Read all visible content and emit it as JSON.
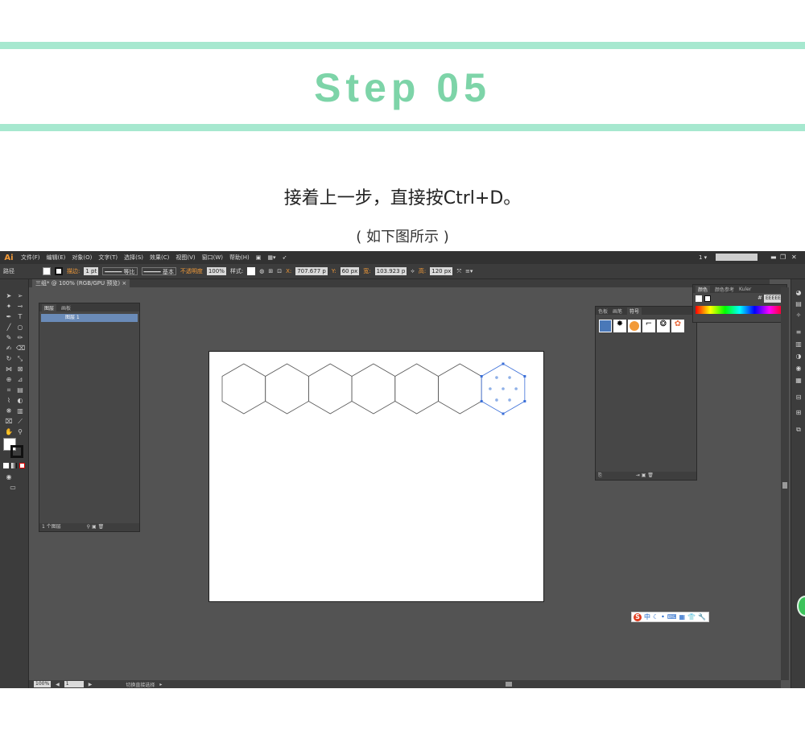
{
  "header": {
    "step_title": "Step 05"
  },
  "instruction": "接着上一步，直接按Ctrl+D。",
  "caption": "( 如下图所示 )",
  "colors": {
    "accent_bar": "#a6e8cf",
    "title_green": "#7dd4a8",
    "ai_orange": "#f29a38",
    "ui_dark": "#535353",
    "selection_blue": "#3b6fd8"
  },
  "app": {
    "logo": "Ai",
    "menu": [
      "文件(F)",
      "编辑(E)",
      "对象(O)",
      "文字(T)",
      "选择(S)",
      "效果(C)",
      "视图(V)",
      "窗口(W)",
      "帮助(H)"
    ],
    "page_indicator": "1 ▾",
    "search_placeholder": "",
    "control_bar": {
      "object_type": "路径",
      "stroke_label": "描边:",
      "stroke_weight": "1 pt",
      "profile": "等比",
      "brush": "基本",
      "opacity_label": "不透明度",
      "opacity_value": "100%",
      "style_label": "样式:",
      "x_label": "X:",
      "x_value": "707.677 p",
      "y_label": "Y:",
      "y_value": "60 px",
      "w_label": "宽:",
      "w_value": "103.923 p",
      "h_label": "高:",
      "h_value": "120 px"
    },
    "doc_tab": "三组* @ 100% (RGB/GPU 预览)",
    "layers_panel": {
      "tabs": [
        "图层",
        "画板"
      ],
      "layer_name": "图层 1",
      "footer": "1 个图层"
    },
    "color_panel": {
      "tabs": [
        "颜色",
        "颜色参考",
        "Kuler"
      ],
      "hex": "EEEEEE"
    },
    "symbols_panel": {
      "tabs": [
        "色板",
        "画笔",
        "符号"
      ]
    },
    "status": {
      "zoom": "100%",
      "artboard_num": "1",
      "info": "切换直接选择"
    },
    "ime": {
      "label": "中"
    }
  }
}
